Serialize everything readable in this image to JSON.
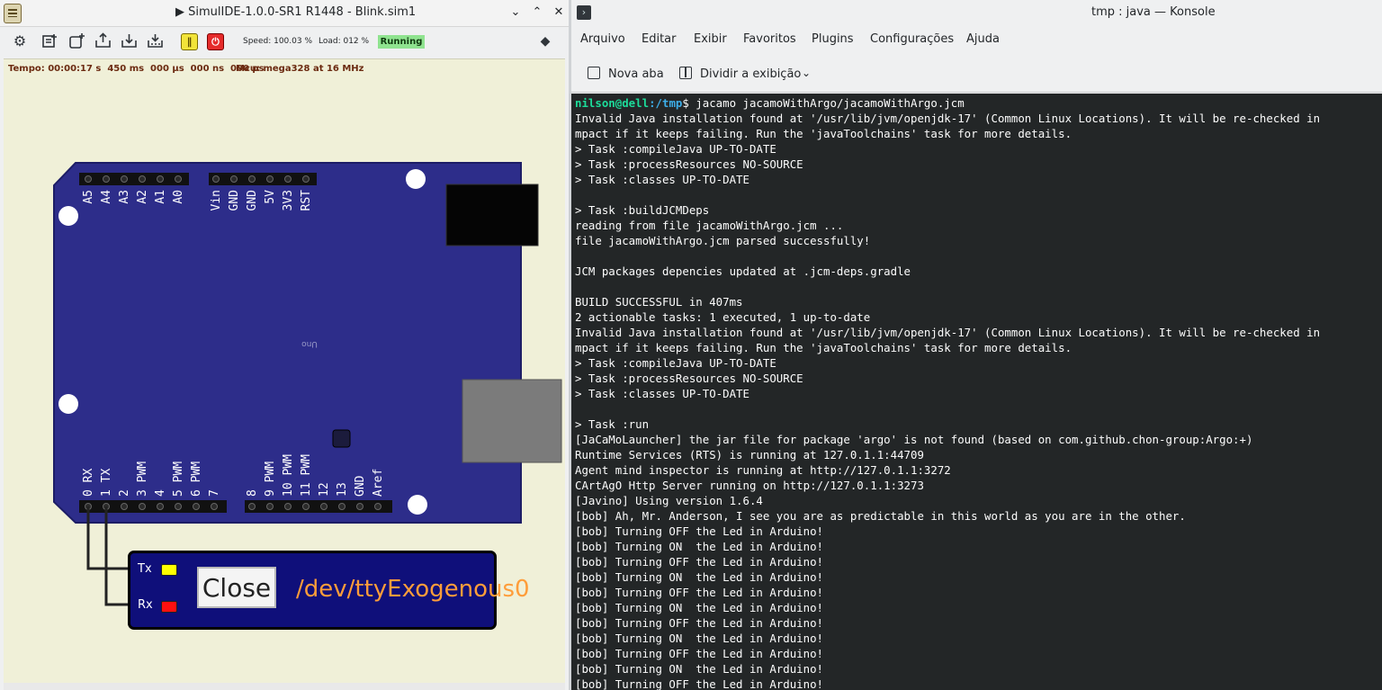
{
  "simulide": {
    "title": "▶ SimulIDE-1.0.0-SR1 R1448 - Blink.sim1",
    "toolbar": {
      "icons": [
        "gear-icon",
        "new-circuit-icon",
        "add-file-icon",
        "open-icon",
        "save-icon",
        "save-as-icon",
        "pause-icon",
        "power-icon",
        "info-icon"
      ],
      "speed": "Speed: 100.03 %",
      "load": "Load: 012 %",
      "status": "Running",
      "status_color": "#8fe38f"
    },
    "canvas": {
      "time": "Tempo: 00:00:17 s  450 ms  000 µs  000 ns  000 ps",
      "mcu": "Mcu: mega328 at 16 MHz"
    },
    "board": {
      "color": "#2d2d8a",
      "model": "Uno",
      "top_pins_left": [
        "A5",
        "A4",
        "A3",
        "A2",
        "A1",
        "A0"
      ],
      "top_pins_right": [
        "Vin",
        "GND",
        "GND",
        "5V",
        "3V3",
        "RST"
      ],
      "bottom_pins_left": [
        "0 RX",
        "1 TX",
        "2",
        "3 PWM",
        "4",
        "5 PWM",
        "6 PWM",
        "7"
      ],
      "bottom_pins_right": [
        "8",
        "9 PWM",
        "10 PWM",
        "11 PWM",
        "12",
        "13",
        "GND",
        "Aref"
      ]
    },
    "serial": {
      "tx_label": "Tx",
      "rx_label": "Rx",
      "close_label": "Close",
      "port": "/dev/ttyExogenous0"
    }
  },
  "konsole": {
    "title": "tmp : java — Konsole",
    "menu": [
      "Arquivo",
      "Editar",
      "Exibir",
      "Favoritos",
      "Plugins",
      "Configurações",
      "Ajuda"
    ],
    "toolbar": {
      "new_tab": "Nova aba",
      "split": "Dividir a exibição"
    },
    "prompt": {
      "user": "nilson@dell",
      "path": ":/tmp",
      "command": "$ jacamo jacamoWithArgo/jacamoWithArgo.jcm"
    },
    "lines": [
      "Invalid Java installation found at '/usr/lib/jvm/openjdk-17' (Common Linux Locations). It will be re-checked in",
      "mpact if it keeps failing. Run the 'javaToolchains' task for more details.",
      "> Task :compileJava UP-TO-DATE",
      "> Task :processResources NO-SOURCE",
      "> Task :classes UP-TO-DATE",
      "",
      "> Task :buildJCMDeps",
      "reading from file jacamoWithArgo.jcm ...",
      "file jacamoWithArgo.jcm parsed successfully!",
      "",
      "JCM packages depencies updated at .jcm-deps.gradle",
      "",
      "BUILD SUCCESSFUL in 407ms",
      "2 actionable tasks: 1 executed, 1 up-to-date",
      "Invalid Java installation found at '/usr/lib/jvm/openjdk-17' (Common Linux Locations). It will be re-checked in",
      "mpact if it keeps failing. Run the 'javaToolchains' task for more details.",
      "> Task :compileJava UP-TO-DATE",
      "> Task :processResources NO-SOURCE",
      "> Task :classes UP-TO-DATE",
      "",
      "> Task :run",
      "[JaCaMoLauncher] the jar file for package 'argo' is not found (based on com.github.chon-group:Argo:+)",
      "Runtime Services (RTS) is running at 127.0.1.1:44709",
      "Agent mind inspector is running at http://127.0.1.1:3272",
      "CArtAgO Http Server running on http://127.0.1.1:3273",
      "[Javino] Using version 1.6.4",
      "[bob] Ah, Mr. Anderson, I see you are as predictable in this world as you are in the other.",
      "[bob] Turning OFF the Led in Arduino!",
      "[bob] Turning ON  the Led in Arduino!",
      "[bob] Turning OFF the Led in Arduino!",
      "[bob] Turning ON  the Led in Arduino!",
      "[bob] Turning OFF the Led in Arduino!",
      "[bob] Turning ON  the Led in Arduino!",
      "[bob] Turning OFF the Led in Arduino!",
      "[bob] Turning ON  the Led in Arduino!",
      "[bob] Turning OFF the Led in Arduino!",
      "[bob] Turning ON  the Led in Arduino!",
      "[bob] Turning OFF the Led in Arduino!"
    ]
  }
}
